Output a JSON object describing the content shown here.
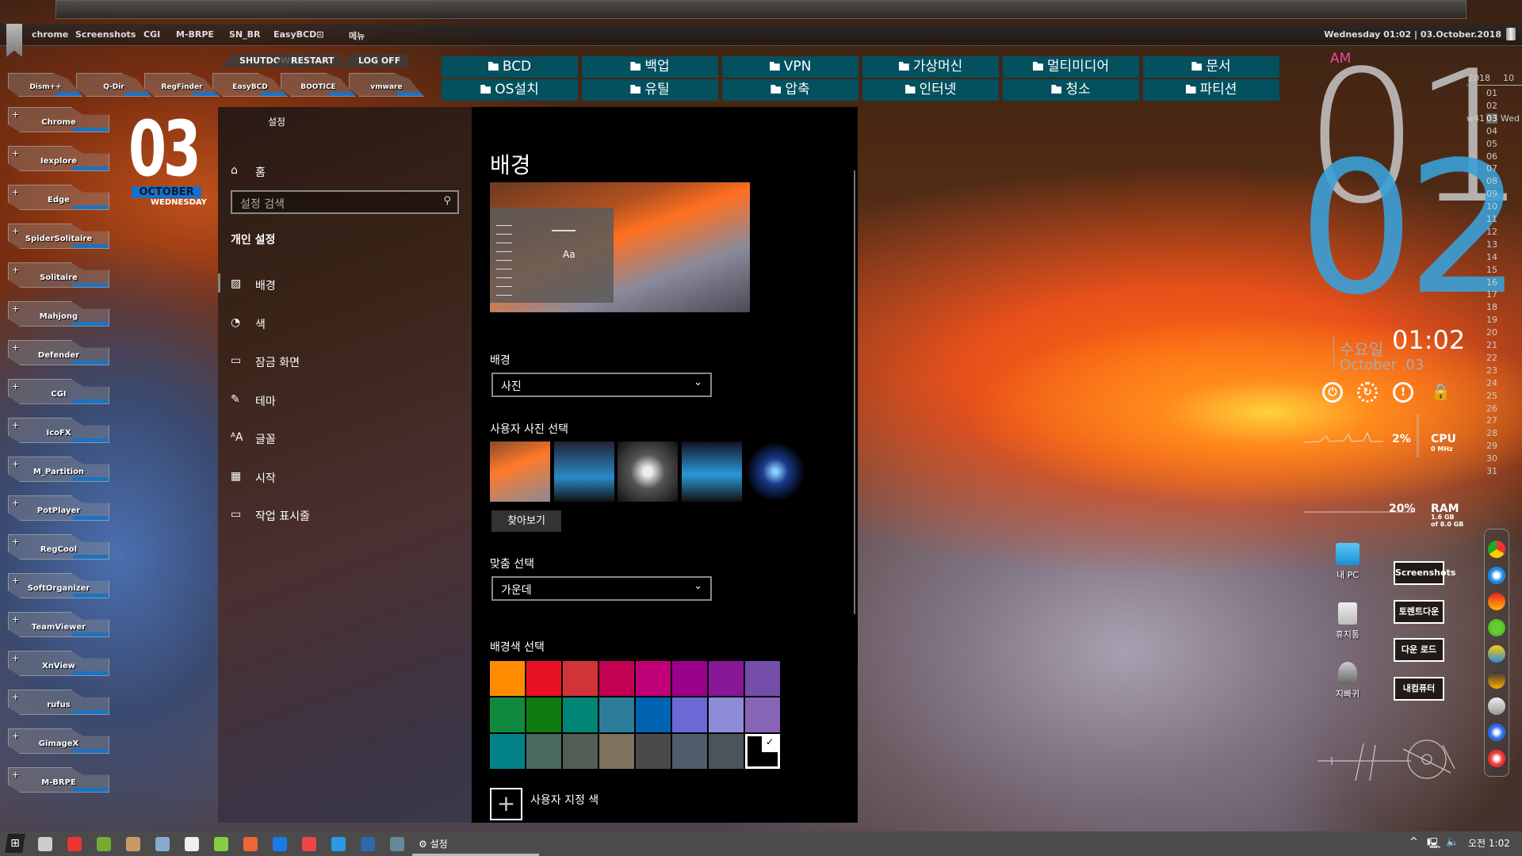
{
  "menubar": {
    "items": [
      "chrome",
      "Screenshots",
      "CGI",
      "M-BRPE",
      "SN_BR",
      "EasyBCD⊡",
      "메뉴"
    ],
    "datetime": "Wednesday 01:02 | 03.October.2018"
  },
  "power_menu": [
    "SHUTDOWN",
    "RESTART",
    "LOG OFF"
  ],
  "launcher_top": [
    "Dism++",
    "Q-Dir",
    "RegFinder",
    "EasyBCD",
    "BOOTICE",
    "vmware"
  ],
  "launcher_left": [
    "Chrome",
    "Iexplore",
    "Edge",
    "SpiderSolitaire",
    "Solitaire",
    "Mahjong",
    "Defender",
    "CGI",
    "IcoFX",
    "M_Partition",
    "PotPlayer",
    "RegCool",
    "SoftOrganizer",
    "TeamViewer",
    "XnView",
    "rufus",
    "GimageX",
    "M-BRPE"
  ],
  "date_widget": {
    "day": "03",
    "month": "OCTOBER",
    "weekday": "WEDNESDAY"
  },
  "folders": [
    "BCD",
    "백업",
    "VPN",
    "가상머신",
    "멀티미디어",
    "문서",
    "OS설치",
    "유틸",
    "압축",
    "인터넷",
    "청소",
    "파티션"
  ],
  "settings": {
    "title": "설정",
    "home": "홈",
    "search_placeholder": "설정 검색",
    "section": "개인 설정",
    "nav": [
      {
        "label": "배경",
        "icon": "picture-icon",
        "selected": true
      },
      {
        "label": "색",
        "icon": "palette-icon"
      },
      {
        "label": "잠금 화면",
        "icon": "lock-screen-icon"
      },
      {
        "label": "테마",
        "icon": "theme-icon"
      },
      {
        "label": "글꼴",
        "icon": "font-icon"
      },
      {
        "label": "시작",
        "icon": "start-icon"
      },
      {
        "label": "작업 표시줄",
        "icon": "taskbar-icon"
      }
    ],
    "page_title": "배경",
    "preview_text": "Aa",
    "background_label": "배경",
    "background_value": "사진",
    "photo_label": "사용자 사진 선택",
    "browse": "찾아보기",
    "fit_label": "맞춤 선택",
    "fit_value": "가운데",
    "color_label": "배경색 선택",
    "colors": [
      "#ff8c00",
      "#e81123",
      "#d13438",
      "#c30052",
      "#bf0077",
      "#9a0089",
      "#881798",
      "#744da9",
      "#10893e",
      "#107c10",
      "#018574",
      "#2d7d9a",
      "#0063b1",
      "#6b69d6",
      "#8e8cd8",
      "#8764b8",
      "#038387",
      "#486860",
      "#525e54",
      "#7e735f",
      "#4c4a48",
      "#515c6b",
      "#4a5459",
      "#000000"
    ],
    "selected_color": "#000000",
    "custom_color": "사용자 지정 색"
  },
  "clock": {
    "ampm": "AM",
    "hour": "01",
    "minute": "02",
    "time": "01:02",
    "dayname": "수요일",
    "monthday": "October .03"
  },
  "calendar": {
    "year": "2018",
    "month": "10",
    "week": "w41",
    "weekday": "Wed",
    "today": "03",
    "days": [
      "01",
      "02",
      "03",
      "04",
      "05",
      "06",
      "07",
      "08",
      "09",
      "10",
      "11",
      "12",
      "13",
      "14",
      "15",
      "16",
      "17",
      "18",
      "19",
      "20",
      "21",
      "22",
      "23",
      "24",
      "25",
      "26",
      "27",
      "28",
      "29",
      "30",
      "31"
    ]
  },
  "system": {
    "cpu_pct": "2%",
    "cpu_label": "CPU",
    "cpu_freq": "0 MHz",
    "ram_pct": "20%",
    "ram_label": "RAM",
    "ram_used": "1.6 GB",
    "ram_total": "of 8.0 GB"
  },
  "desktop_icons": [
    "내 PC",
    "휴지통",
    "지빠귀"
  ],
  "shortcuts": [
    "Screenshots",
    "토렌트다운",
    "다운 로드",
    "내컴퓨터"
  ],
  "dock": [
    "chrome",
    "internet-explorer",
    "ccleaner",
    "clover",
    "winamp",
    "xnview",
    "eraser",
    "back",
    "power"
  ],
  "taskbar": {
    "settings_label": "설정",
    "clock": "오전 1:02"
  },
  "accent": "#1a6fc4",
  "folder_color": "#03505e"
}
